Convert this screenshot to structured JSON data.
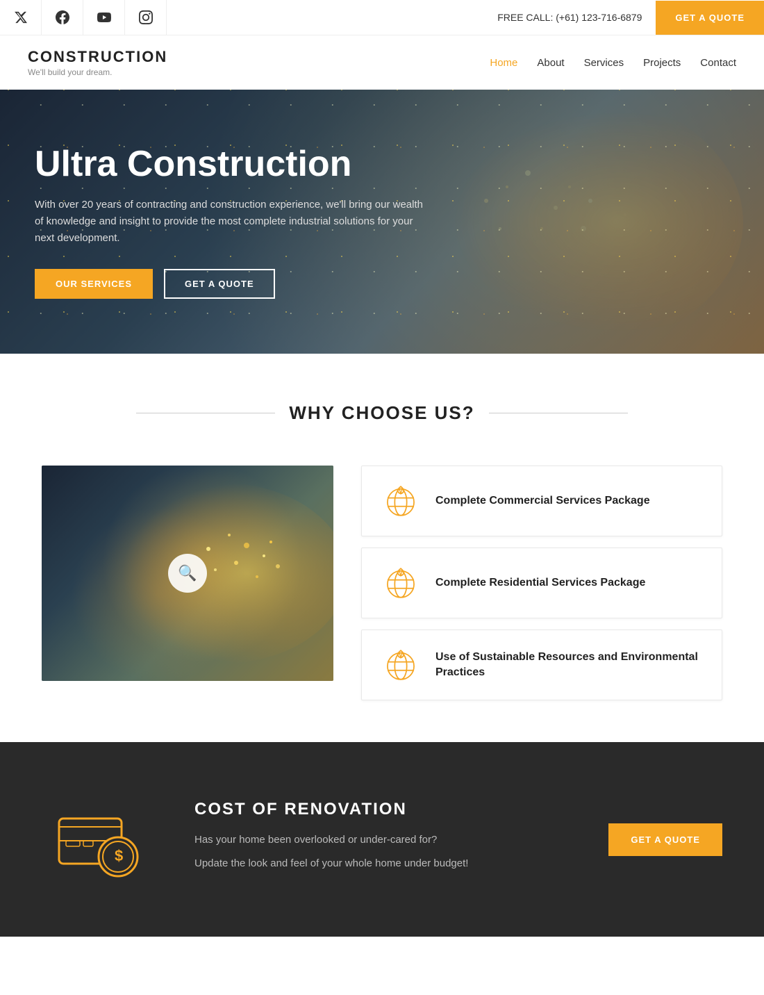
{
  "topbar": {
    "free_call_label": "FREE CALL: (+61) 123-716-6879",
    "get_quote_label": "GET A QUOTE"
  },
  "social": {
    "twitter": "𝕏",
    "facebook": "f",
    "youtube": "▶",
    "instagram": "◻"
  },
  "header": {
    "logo_title": "CONSTRUCTION",
    "logo_sub": "We'll build your dream.",
    "nav": [
      {
        "label": "Home",
        "active": true
      },
      {
        "label": "About",
        "active": false
      },
      {
        "label": "Services",
        "active": false
      },
      {
        "label": "Projects",
        "active": false
      },
      {
        "label": "Contact",
        "active": false
      }
    ]
  },
  "hero": {
    "title": "Ultra Construction",
    "description": "With over 20 years of contracting and construction experience, we'll bring our wealth of knowledge and insight to provide the most complete industrial solutions for your next development.",
    "btn_services": "OUR SERVICES",
    "btn_quote": "GET A QUOTE"
  },
  "why": {
    "section_title": "WHY CHOOSE US?",
    "cards": [
      {
        "label": "Complete Commercial Services Package"
      },
      {
        "label": "Complete Residential Services Package"
      },
      {
        "label": "Use of Sustainable Resources and Environmental Practices"
      }
    ]
  },
  "renovation": {
    "section_title": "COST OF RENOVATION",
    "desc1": "Has your home been overlooked or under-cared for?",
    "desc2": "Update the look and feel of your whole home under budget!",
    "btn_label": "GET A QUOTE"
  }
}
